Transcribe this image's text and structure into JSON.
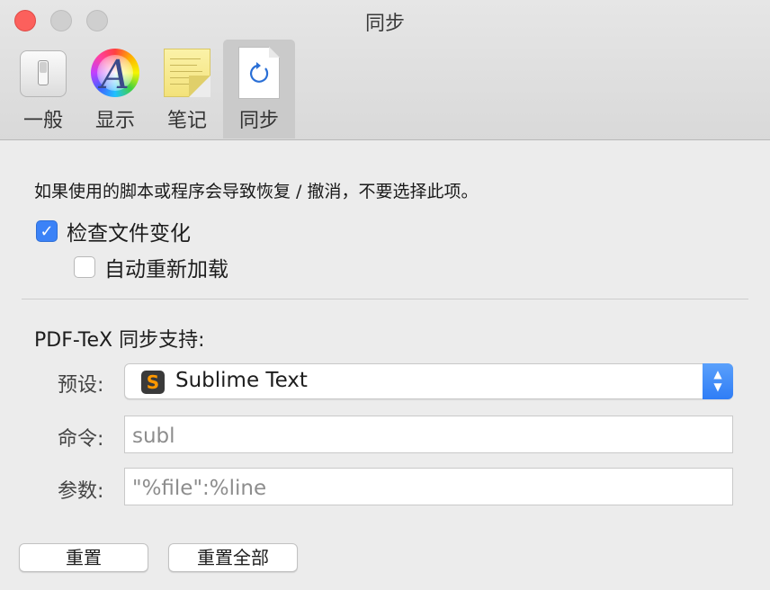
{
  "window": {
    "title": "同步"
  },
  "toolbar": {
    "items": [
      {
        "label": "一般",
        "icon": "switch-icon"
      },
      {
        "label": "显示",
        "icon": "color-wheel-icon"
      },
      {
        "label": "笔记",
        "icon": "note-icon"
      },
      {
        "label": "同步",
        "icon": "sync-document-icon",
        "selected": true
      }
    ]
  },
  "content": {
    "description": "如果使用的脚本或程序会导致恢复 / 撤消，不要选择此项。",
    "check_file_changes": {
      "label": "检查文件变化",
      "checked": true
    },
    "auto_reload": {
      "label": "自动重新加载",
      "checked": false
    },
    "sync_section_title": "PDF-TeX 同步支持:",
    "preset": {
      "label": "预设:",
      "value": "Sublime Text",
      "icon": "S"
    },
    "command": {
      "label": "命令:",
      "placeholder": "subl"
    },
    "arguments": {
      "label": "参数:",
      "placeholder": "\"%file\":%line"
    }
  },
  "buttons": {
    "reset": "重置",
    "reset_all": "重置全部"
  },
  "colors": {
    "accent": "#3b82f7",
    "close": "#fc605c"
  }
}
